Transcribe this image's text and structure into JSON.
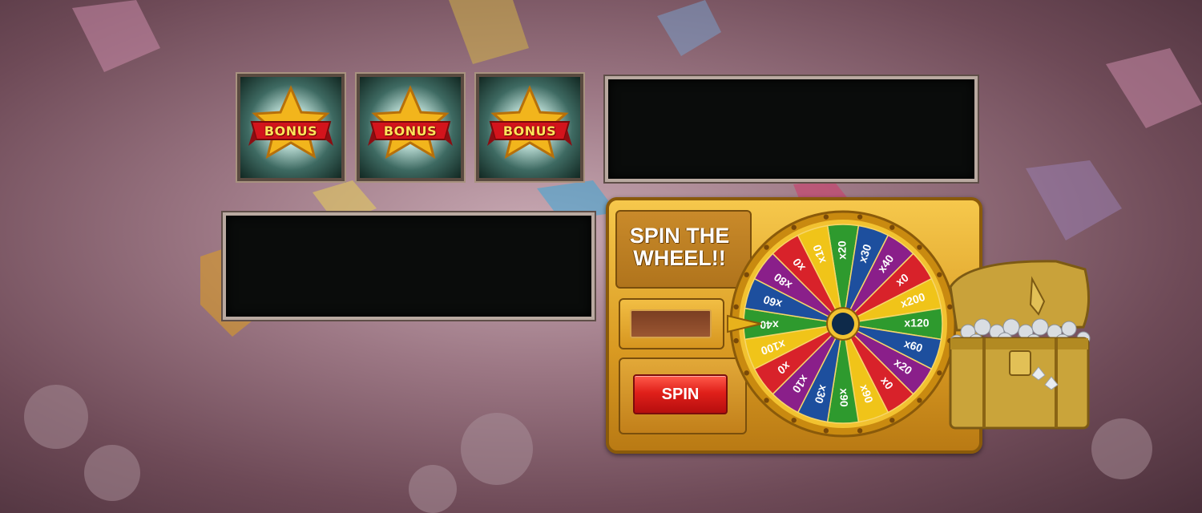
{
  "bonus_tiles": [
    {
      "label": "BONUS"
    },
    {
      "label": "BONUS"
    },
    {
      "label": "BONUS"
    }
  ],
  "spin_panel": {
    "title_line1": "SPIN THE",
    "title_line2": "WHEEL!!",
    "input_value": "",
    "spin_button_label": "SPIN"
  },
  "wheel": {
    "segments": [
      {
        "label": "x20",
        "color": "#2e9a2e"
      },
      {
        "label": "x30",
        "color": "#1d4f9e"
      },
      {
        "label": "x40",
        "color": "#8a1f8a"
      },
      {
        "label": "x0",
        "color": "#d8222a"
      },
      {
        "label": "x200",
        "color": "#f0c419"
      },
      {
        "label": "x120",
        "color": "#2e9a2e"
      },
      {
        "label": "x60",
        "color": "#1d4f9e"
      },
      {
        "label": "x20",
        "color": "#8a1f8a"
      },
      {
        "label": "x0",
        "color": "#d8222a"
      },
      {
        "label": "x90",
        "color": "#f0c419"
      },
      {
        "label": "x90",
        "color": "#2e9a2e"
      },
      {
        "label": "x30",
        "color": "#1d4f9e"
      },
      {
        "label": "x10",
        "color": "#8a1f8a"
      },
      {
        "label": "x0",
        "color": "#d8222a"
      },
      {
        "label": "x100",
        "color": "#f0c419"
      },
      {
        "label": "x40",
        "color": "#2e9a2e"
      },
      {
        "label": "x60",
        "color": "#1d4f9e"
      },
      {
        "label": "x80",
        "color": "#8a1f8a"
      },
      {
        "label": "x0",
        "color": "#d8222a"
      },
      {
        "label": "x10",
        "color": "#f0c419"
      }
    ],
    "rim_color": "#e8b21c",
    "hub_color": "#0e2a4a"
  },
  "icons": {
    "bonus_star": "star-icon",
    "wheel_pointer": "pointer-icon",
    "treasure": "treasure-chest-icon"
  }
}
